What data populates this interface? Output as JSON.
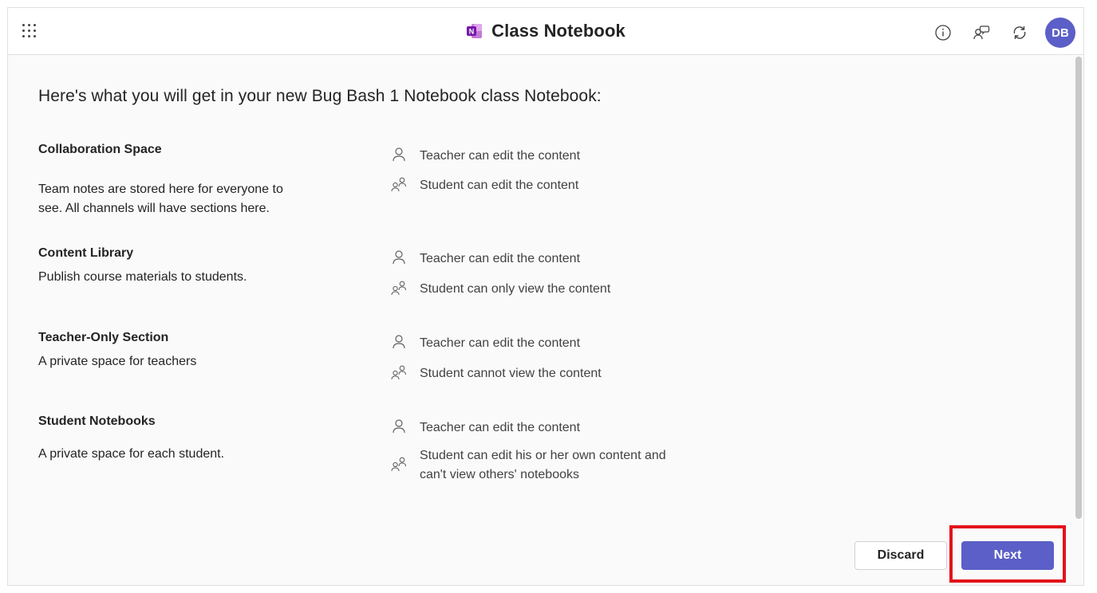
{
  "header": {
    "app_title": "Class Notebook",
    "avatar_initials": "DB",
    "icons": [
      "app-launcher-icon",
      "onenote-logo-icon",
      "info-icon",
      "chat-icon",
      "refresh-icon"
    ]
  },
  "main": {
    "heading": "Here's what you will get in your new Bug Bash 1 Notebook class Notebook:",
    "sections": [
      {
        "title": "Collaboration Space",
        "description": "Team notes are stored here for everyone to see. All channels will have sections here.",
        "teacher_permission": "Teacher can edit the content",
        "student_permission": "Student can edit the content"
      },
      {
        "title": "Content Library",
        "description": "Publish course materials to students.",
        "teacher_permission": "Teacher can edit the content",
        "student_permission": "Student can only view the content"
      },
      {
        "title": "Teacher-Only Section",
        "description": "A private space for teachers",
        "teacher_permission": "Teacher can edit the content",
        "student_permission": "Student cannot view the content"
      },
      {
        "title": "Student Notebooks",
        "description": "A private space for each student.",
        "teacher_permission": "Teacher can edit the content",
        "student_permission": "Student can edit his or her own content and can't view others' notebooks"
      }
    ]
  },
  "footer": {
    "discard_label": "Discard",
    "next_label": "Next"
  },
  "colors": {
    "accent": "#5b5fc7",
    "highlight": "#e3131b",
    "background": "#fafafa"
  }
}
